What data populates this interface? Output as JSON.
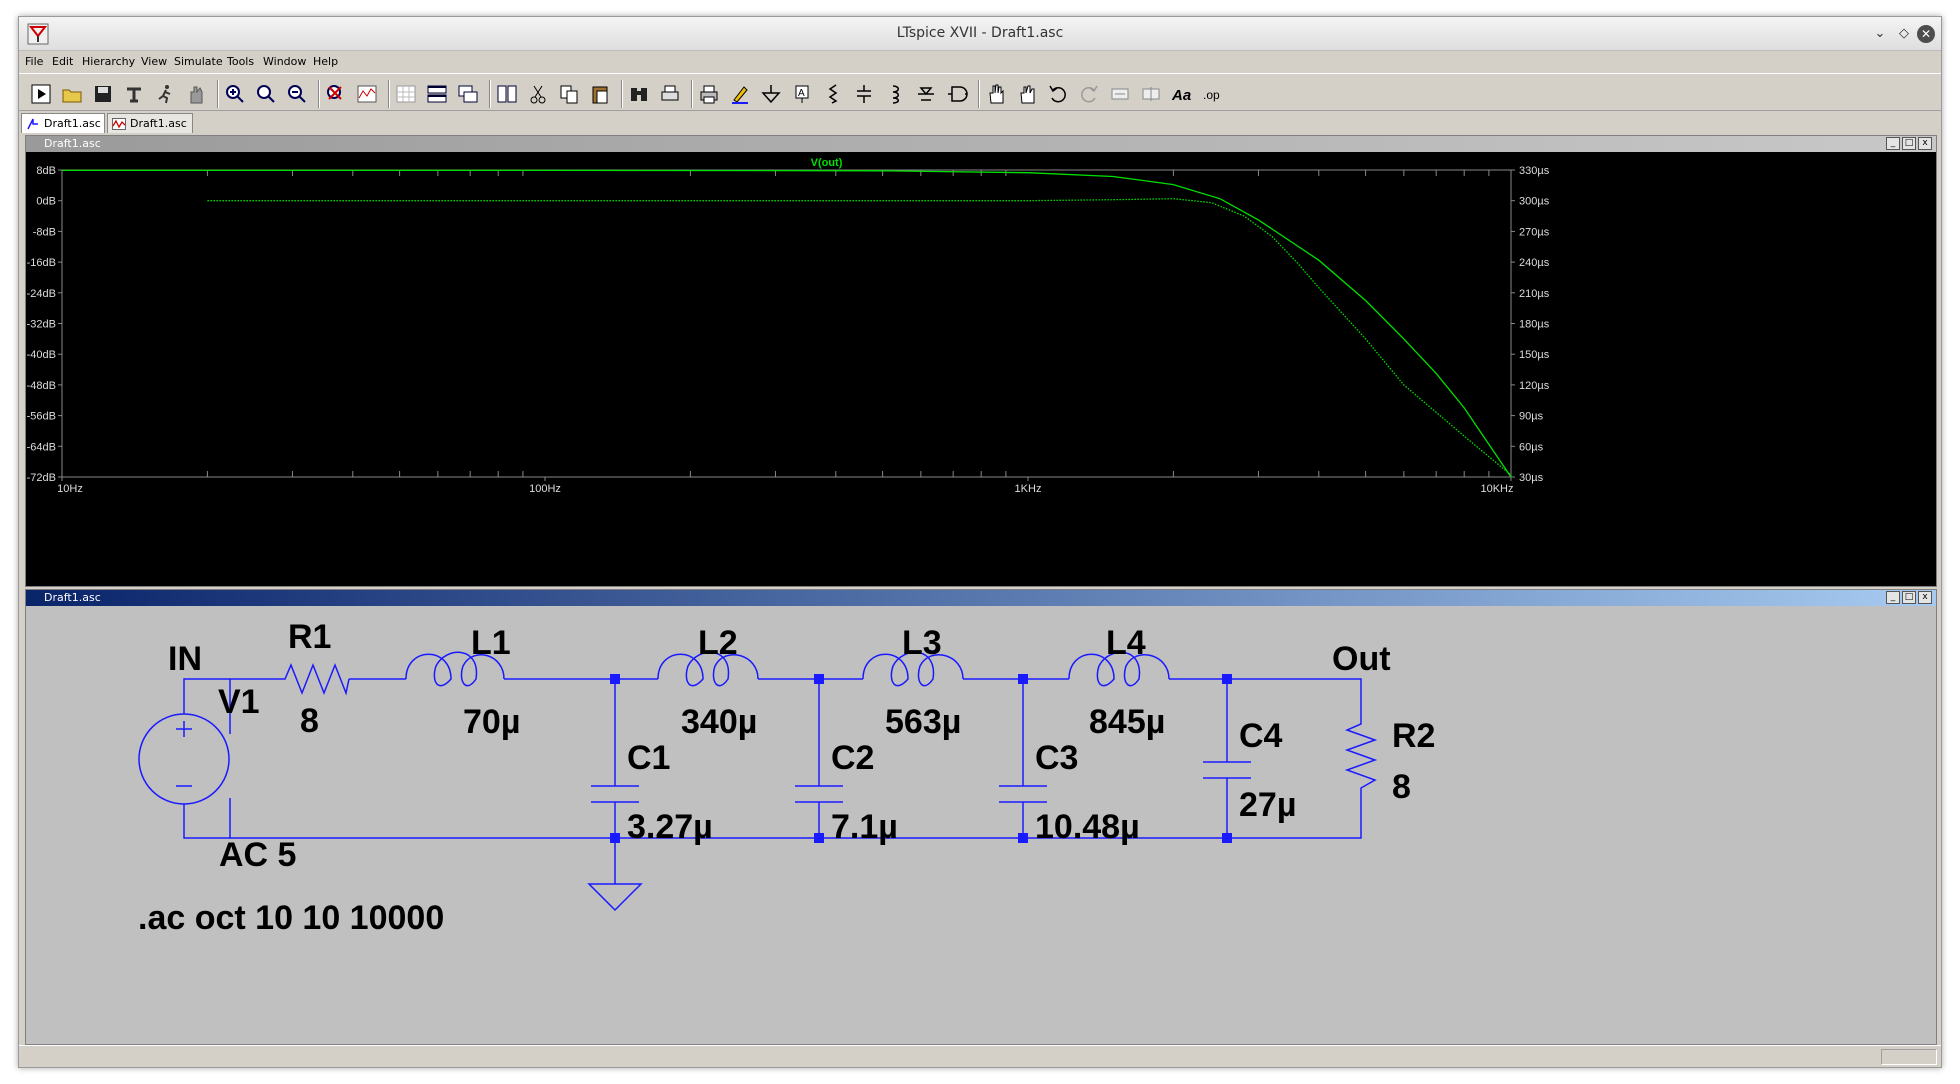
{
  "window": {
    "title": "LTspice XVII - Draft1.asc",
    "controls": {
      "minimize": "⌄",
      "maximize": "◇",
      "close": "✕"
    }
  },
  "menu": [
    "File",
    "Edit",
    "Hierarchy",
    "View",
    "Simulate",
    "Tools",
    "Window",
    "Help"
  ],
  "toolbar": [
    "run-icon",
    "open-folder-icon",
    "save-icon",
    "control-panel-icon",
    "run-man-icon",
    "halt-hand-icon",
    "zoom-in-icon",
    "zoom-pan-icon",
    "zoom-out-icon",
    "zoom-fit-icon",
    "autorange-icon",
    "grid-icon",
    "tile-horizontal-icon",
    "cascade-icon",
    "tile-vertical-icon",
    "cut-icon",
    "copy-icon",
    "paste-icon",
    "find-icon",
    "print-preview-icon",
    "print-icon",
    "wire-pencil-icon",
    "ground-icon",
    "label-net-icon",
    "resistor-icon",
    "capacitor-icon",
    "inductor-icon",
    "diode-icon",
    "component-icon",
    "move-hand-icon",
    "drag-hand-icon",
    "undo-icon",
    "redo-icon",
    "rotate-icon",
    "mirror-icon",
    "text-icon",
    "spice-directive-icon"
  ],
  "toolbar_text": {
    "text": "Aa",
    "directive": ".op"
  },
  "tabs": [
    {
      "label": "Draft1.asc",
      "kind": "schematic"
    },
    {
      "label": "Draft1.asc",
      "kind": "waveform"
    }
  ],
  "plot_pane": {
    "title": "Draft1.asc",
    "trace_label": "V(out)",
    "trace_color": "#00e000",
    "chart_data": {
      "type": "line",
      "x_scale": "log",
      "x_ticks": [
        "10Hz",
        "100Hz",
        "1KHz",
        "10KHz"
      ],
      "x_tick_values": [
        10,
        100,
        1000,
        10000
      ],
      "xlim": [
        10,
        10000
      ],
      "y_ticks": [
        "8dB",
        "0dB",
        "-8dB",
        "-16dB",
        "-24dB",
        "-32dB",
        "-40dB",
        "-48dB",
        "-56dB",
        "-64dB",
        "-72dB"
      ],
      "ylim": [
        -72,
        8
      ],
      "y2_ticks": [
        "330µs",
        "300µs",
        "270µs",
        "240µs",
        "210µs",
        "180µs",
        "150µs",
        "120µs",
        "90µs",
        "60µs",
        "30µs"
      ],
      "y2lim": [
        30,
        330
      ],
      "series": [
        {
          "name": "V(out)",
          "axis": "left",
          "style": "solid",
          "x": [
            10,
            100,
            500,
            1000,
            1500,
            2000,
            2500,
            3000,
            4000,
            5000,
            6000,
            7000,
            8000,
            10000
          ],
          "y": [
            7.9,
            7.9,
            7.8,
            7.3,
            6.3,
            4.2,
            0.5,
            -5,
            -15.5,
            -26,
            -36,
            -45,
            -54,
            -72
          ]
        },
        {
          "name": "",
          "axis": "right",
          "style": "dotted",
          "x": [
            20,
            100,
            500,
            1000,
            1500,
            2000,
            2400,
            2800,
            3200,
            3600,
            4000,
            5000,
            6000,
            8000,
            10000
          ],
          "y": [
            300,
            300,
            300,
            300,
            301,
            302,
            298,
            285,
            265,
            240,
            215,
            165,
            120,
            70,
            32
          ]
        }
      ]
    }
  },
  "schematic_pane": {
    "title": "Draft1.asc",
    "wire_color": "#1a1aff",
    "labels": {
      "in": "IN",
      "out": "Out",
      "v1": "V1",
      "v1_value": "AC 5",
      "r1": "R1",
      "r1_value": "8",
      "r2": "R2",
      "r2_value": "8",
      "l1": "L1",
      "l1_value": "70µ",
      "l2": "L2",
      "l2_value": "340µ",
      "l3": "L3",
      "l3_value": "563µ",
      "l4": "L4",
      "l4_value": "845µ",
      "c1": "C1",
      "c1_value": "3.27µ",
      "c2": "C2",
      "c2_value": "7.1µ",
      "c3": "C3",
      "c3_value": "10.48µ",
      "c4": "C4",
      "c4_value": "27µ",
      "directive": ".ac oct 10 10 10000"
    }
  }
}
